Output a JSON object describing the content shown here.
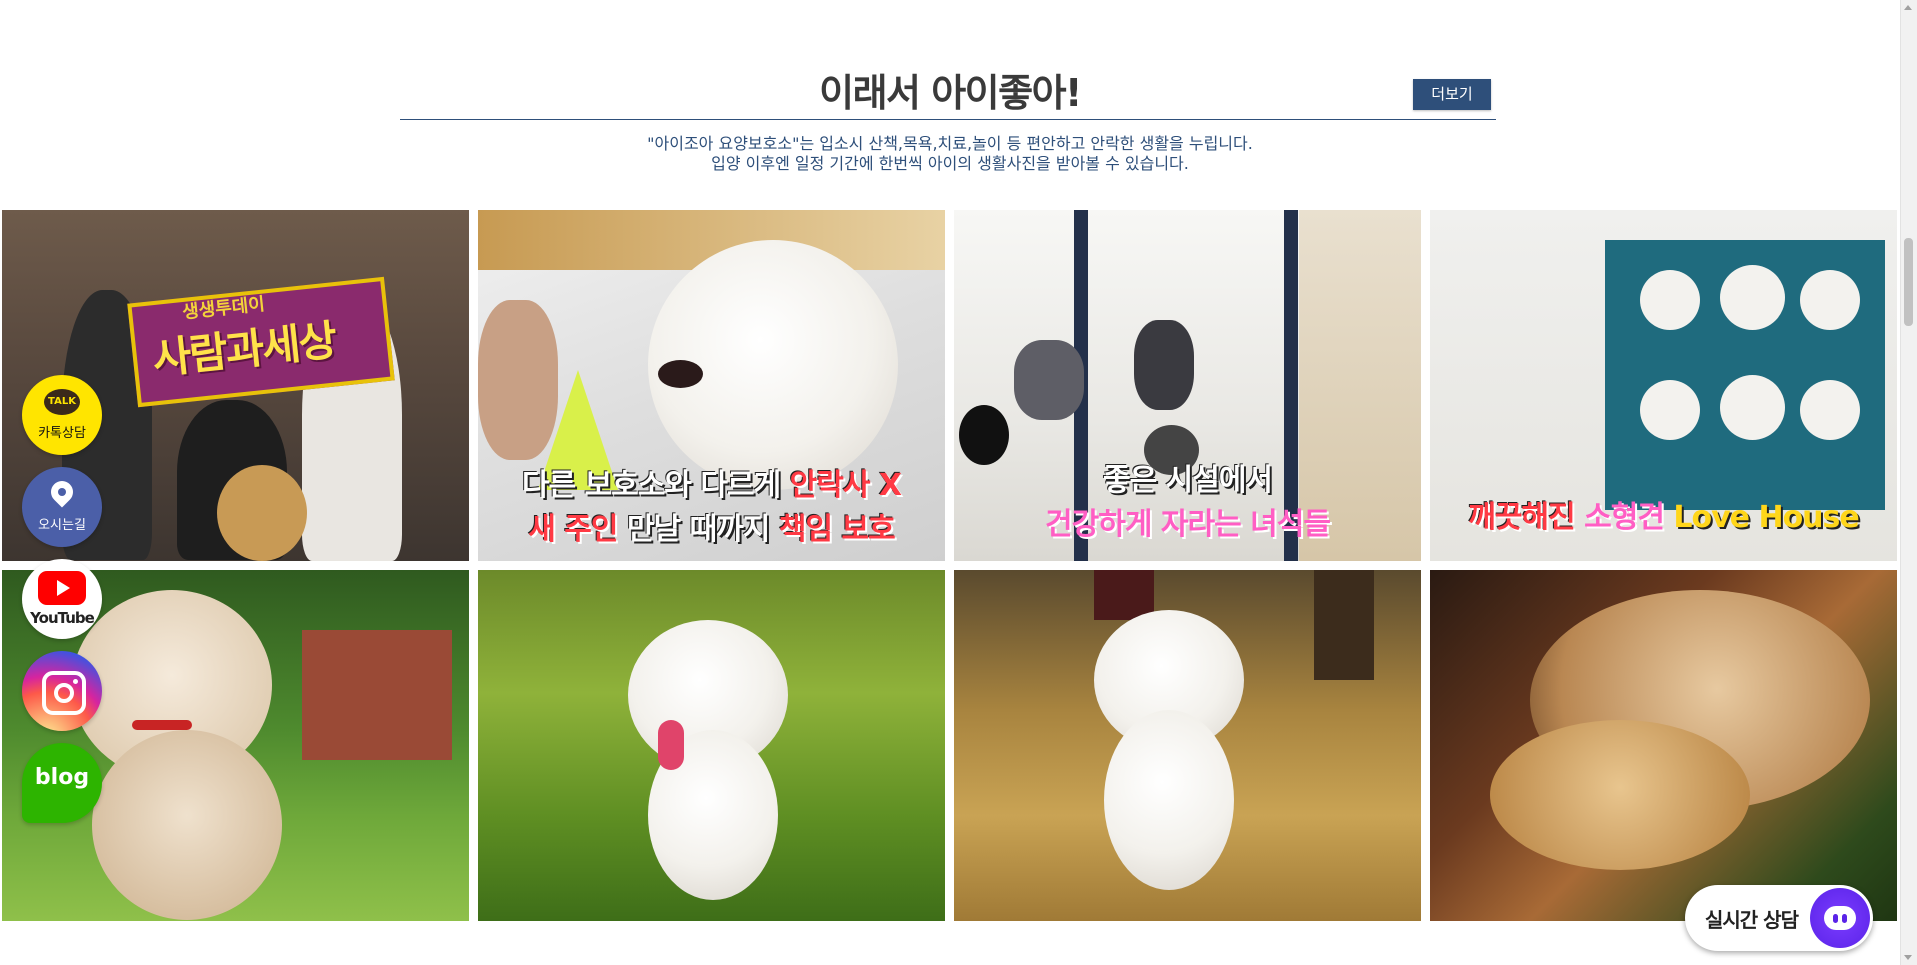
{
  "section": {
    "title": "이래서 아이좋아!",
    "more_label": "더보기",
    "desc_line1": "\"아이조아 요양보호소\"는 입소시 산책,목욕,치료,놀이 등 편안하고 안락한 생활을 누립니다.",
    "desc_line2": "입양 이후엔 일정 기간에 한번씩 아이의 생활사진을 받아볼 수 있습니다."
  },
  "tiles": [
    {
      "tag_small": "생생투데이",
      "tag_big": "사람과세상"
    },
    {
      "caption_line1_a": "다른 보호소와 다르게 ",
      "caption_line1_b": "안락사 X",
      "caption_line2_a": "새 주인",
      "caption_line2_b": " 만날 때까지 ",
      "caption_line2_c": "책임 보호"
    },
    {
      "caption_line1": "좋은 시설에서",
      "caption_line2": "건강하게 자라는 녀석들"
    },
    {
      "caption_a": "깨끗해진 ",
      "caption_b": "소형견",
      "caption_c": " Love House"
    }
  ],
  "floating": {
    "kakao_badge": "TALK",
    "kakao_label": "카톡상담",
    "location_label": "오시는길",
    "youtube_label": "YouTube",
    "blog_label": "blog"
  },
  "chat": {
    "label": "실시간 상담"
  },
  "colors": {
    "brand": "#2e4f7a",
    "kakao": "#ffe500",
    "chat": "#5a23e8"
  }
}
